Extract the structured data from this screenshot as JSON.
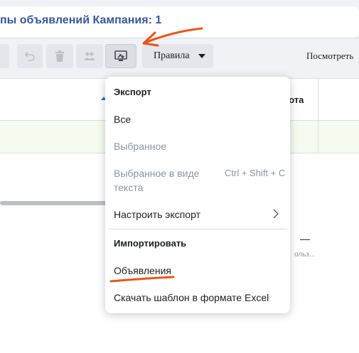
{
  "header": {
    "title": "пы объявлений Кампания: 1"
  },
  "toolbar": {
    "rules_label": "Правила",
    "view_label": "Посмотреть"
  },
  "table": {
    "column_header": "тота",
    "row1_value": "—",
    "row2_value": "—",
    "row2_sub": "ольз..."
  },
  "export_menu": {
    "export_heading": "Экспорт",
    "all": "Все",
    "selected": "Выбранное",
    "selected_as_text": "Выбранное в виде текста",
    "shortcut": "Ctrl + Shift + C",
    "customize_export": "Настроить экспорт",
    "import_heading": "Импортировать",
    "ads": "Объявления",
    "download_template": "Скачать шаблон в формате Excel"
  },
  "colors": {
    "title": "#385898",
    "annotation": "#e8561a",
    "row_highlight": "#f5fbef",
    "accent": "#1877f2"
  },
  "icons": [
    "undo-icon",
    "trash-icon",
    "people-icon",
    "export-icon",
    "caret-down-icon",
    "chevron-right-icon"
  ]
}
